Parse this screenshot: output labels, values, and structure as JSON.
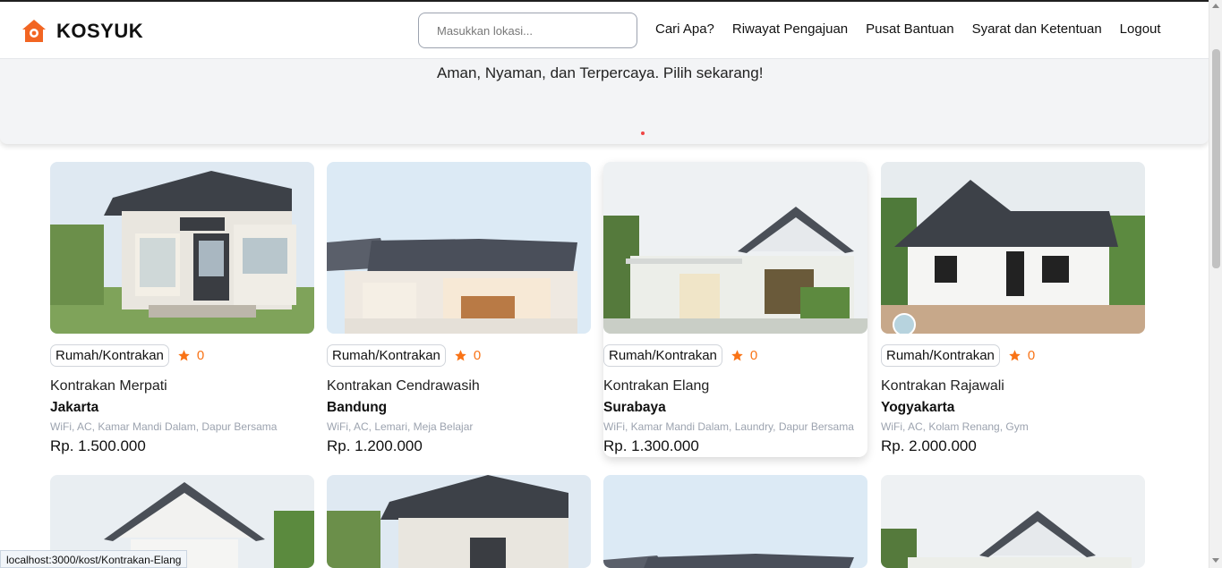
{
  "brand": {
    "name": "KOSYUK",
    "accent": "#f26522"
  },
  "search": {
    "placeholder": "Masukkan lokasi..."
  },
  "nav": {
    "items": [
      "Cari Apa?",
      "Riwayat Pengajuan",
      "Pusat Bantuan",
      "Syarat dan Ketentuan",
      "Logout"
    ]
  },
  "hero": {
    "subtitle": "Aman, Nyaman, dan Terpercaya. Pilih sekarang!"
  },
  "listings": [
    {
      "category": "Rumah/Kontrakan",
      "rating": "0",
      "name": "Kontrakan Merpati",
      "city": "Jakarta",
      "facilities": "WiFi, AC, Kamar Mandi Dalam, Dapur Bersama",
      "price": "Rp. 1.500.000"
    },
    {
      "category": "Rumah/Kontrakan",
      "rating": "0",
      "name": "Kontrakan Cendrawasih",
      "city": "Bandung",
      "facilities": "WiFi, AC, Lemari, Meja Belajar",
      "price": "Rp. 1.200.000"
    },
    {
      "category": "Rumah/Kontrakan",
      "rating": "0",
      "name": "Kontrakan Elang",
      "city": "Surabaya",
      "facilities": "WiFi, Kamar Mandi Dalam, Laundry, Dapur Bersama",
      "price": "Rp. 1.300.000"
    },
    {
      "category": "Rumah/Kontrakan",
      "rating": "0",
      "name": "Kontrakan Rajawali",
      "city": "Yogyakarta",
      "facilities": "WiFi, AC, Kolam Renang, Gym",
      "price": "Rp. 2.000.000"
    }
  ],
  "status_bar": {
    "url": "localhost:3000/kost/Kontrakan-Elang"
  },
  "colors": {
    "star": "#f97316",
    "hero_bg": "#f3f4f6",
    "dot": "#ef4444"
  }
}
